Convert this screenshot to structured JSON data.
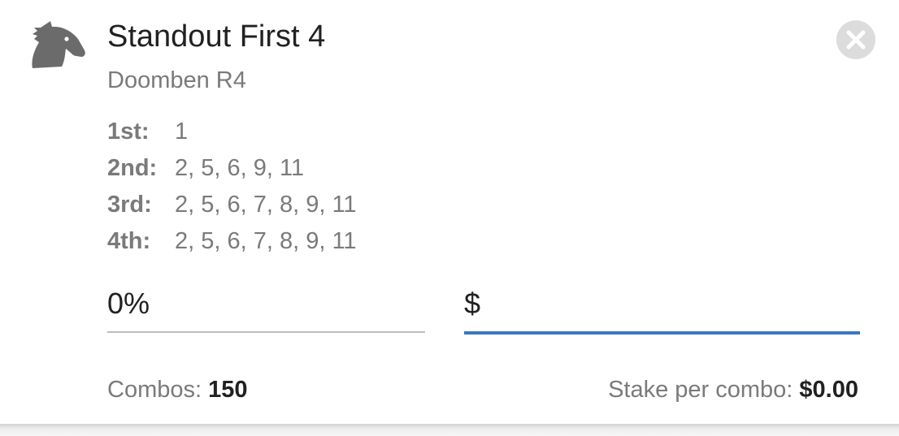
{
  "bet": {
    "icon": "horse-head-icon",
    "title": "Standout First 4",
    "subtitle": "Doomben R4",
    "close_icon": "close-icon"
  },
  "selections": [
    {
      "label": "1st:",
      "value": "1"
    },
    {
      "label": "2nd:",
      "value": "2, 5, 6, 9, 11"
    },
    {
      "label": "3rd:",
      "value": "2, 5, 6, 7, 8, 9, 11"
    },
    {
      "label": "4th:",
      "value": "2, 5, 6, 7, 8, 9, 11"
    }
  ],
  "percent_field": {
    "value": "0%"
  },
  "stake_field": {
    "prefix": "$",
    "value": ""
  },
  "summary": {
    "combos_label": "Combos:",
    "combos_value": "150",
    "stake_label": "Stake per combo:",
    "stake_value": "$0.00"
  },
  "colors": {
    "accent": "#3a77c6",
    "icon": "#6b6b6b",
    "close_bg": "#dcdcdc"
  }
}
